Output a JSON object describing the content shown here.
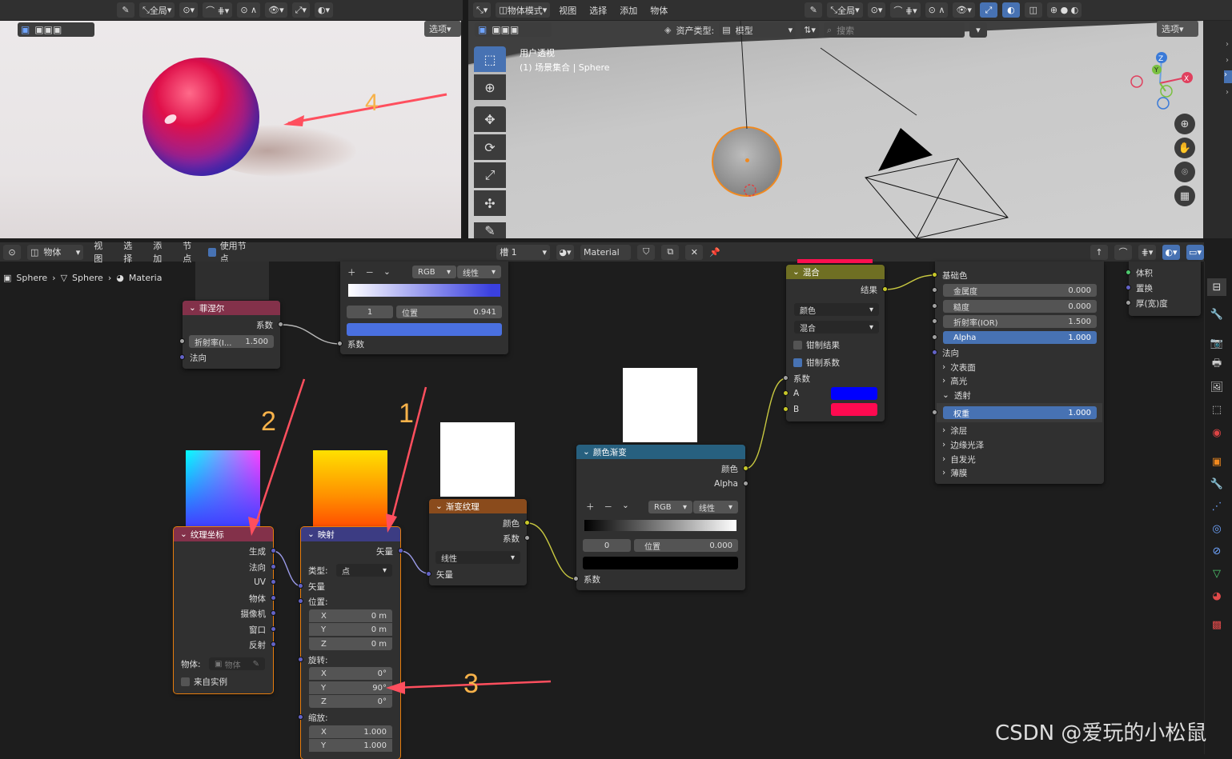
{
  "top_left_header": {
    "select_box": "全局",
    "options": "选项"
  },
  "viewport": {
    "mode": "物体模式",
    "menus": [
      "视图",
      "选择",
      "添加",
      "物体"
    ],
    "transform": "全局",
    "asset_type_label": "资产类型:",
    "asset_type": "模型",
    "search_placeholder": "搜索",
    "options": "选项",
    "view_name": "用户透视",
    "collection": "(1) 场景集合 | Sphere"
  },
  "node_header": {
    "editor_type": "物体",
    "menus": [
      "视图",
      "选择",
      "添加",
      "节点"
    ],
    "use_nodes": "使用节点",
    "slot": "槽 1",
    "material": "Material"
  },
  "breadcrumb": {
    "items": [
      "Sphere",
      "Sphere",
      "Materia"
    ]
  },
  "annotations": {
    "a1": "1",
    "a2": "2",
    "a3": "3",
    "a4": "4"
  },
  "ramp_top": {
    "mode": "RGB",
    "interp": "线性",
    "index": "1",
    "pos_label": "位置",
    "pos_value": "0.941",
    "out_label": "系数"
  },
  "fresnel": {
    "title": "菲涅尔",
    "out": "系数",
    "ior_label": "折射率(I...",
    "ior_value": "1.500",
    "normal": "法向"
  },
  "texcoord": {
    "title": "纹理坐标",
    "outs": [
      "生成",
      "法向",
      "UV",
      "物体",
      "摄像机",
      "窗口",
      "反射"
    ],
    "object_label": "物体:",
    "object_placeholder": "物体",
    "from_instance": "来自实例"
  },
  "mapping": {
    "title": "映射",
    "out": "矢量",
    "type_label": "类型:",
    "type_value": "点",
    "vector_in": "矢量",
    "loc_label": "位置:",
    "loc": [
      [
        "X",
        "0 m"
      ],
      [
        "Y",
        "0 m"
      ],
      [
        "Z",
        "0 m"
      ]
    ],
    "rot_label": "旋转:",
    "rot": [
      [
        "X",
        "0°"
      ],
      [
        "Y",
        "90°"
      ],
      [
        "Z",
        "0°"
      ]
    ],
    "scale_label": "缩放:",
    "scale": [
      [
        "X",
        "1.000"
      ],
      [
        "Y",
        "1.000"
      ]
    ]
  },
  "gradient": {
    "title": "渐变纹理",
    "out_color": "颜色",
    "out_fac": "系数",
    "type": "线性",
    "in_vector": "矢量"
  },
  "colorramp": {
    "title": "颜色渐变",
    "out_color": "颜色",
    "out_alpha": "Alpha",
    "mode": "RGB",
    "interp": "线性",
    "index": "0",
    "pos_label": "位置",
    "pos_value": "0.000",
    "in_fac": "系数"
  },
  "mix": {
    "title": "混合",
    "out": "结果",
    "type1": "颜色",
    "type2": "混合",
    "clamp_result": "钳制结果",
    "clamp_factor": "钳制系数",
    "fac": "系数",
    "a": "A",
    "b": "B"
  },
  "bsdf": {
    "base_color": "基础色",
    "fields": [
      [
        "金属度",
        "0.000"
      ],
      [
        "糙度",
        "0.000"
      ],
      [
        "折射率(IOR)",
        "1.500"
      ],
      [
        "Alpha",
        "1.000"
      ]
    ],
    "normal": "法向",
    "sub": [
      "次表面",
      "高光",
      "透射"
    ],
    "weight_label": "权重",
    "weight_value": "1.000",
    "sub2": [
      "涂层",
      "边缘光泽",
      "自发光",
      "薄膜"
    ]
  },
  "output": {
    "items": [
      "体积",
      "置换",
      "厚(宽)度"
    ]
  },
  "watermark": "CSDN @爱玩的小松鼠"
}
